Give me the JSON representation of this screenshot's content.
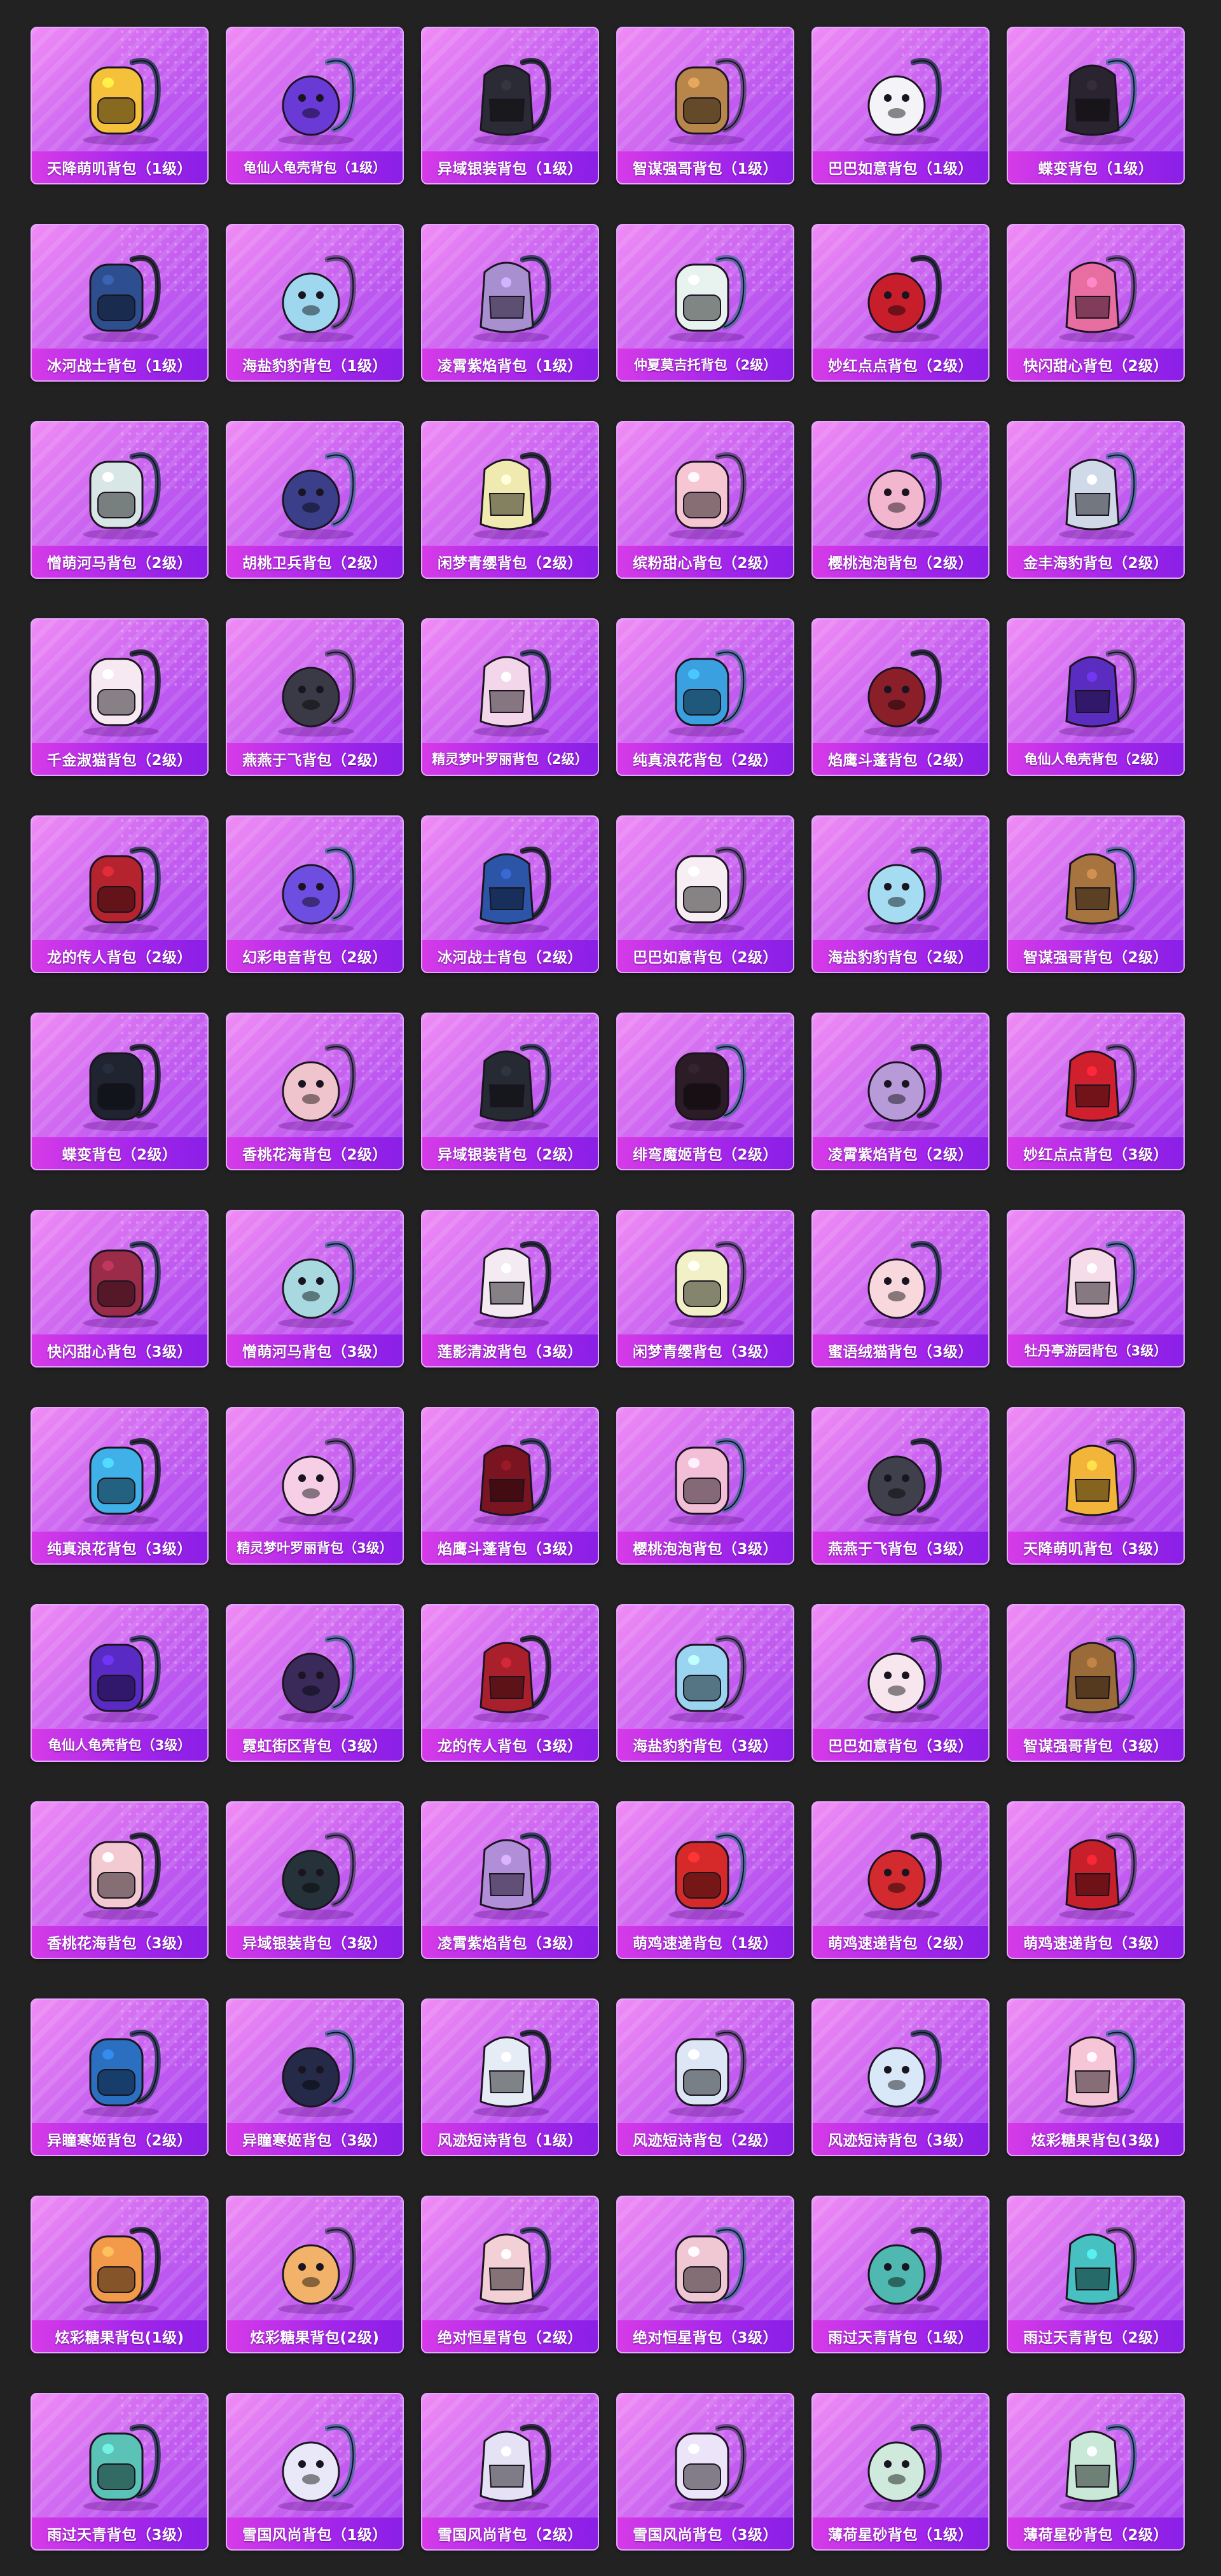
{
  "items": [
    {
      "name": "天降萌叽背包（1级）",
      "icon": "yellow-chick-backpack-icon",
      "color": "#f5c13a"
    },
    {
      "name": "龟仙人龟壳背包（1级）",
      "icon": "turtle-shell-backpack-icon",
      "color": "#6a3ad6"
    },
    {
      "name": "异域银装背包（1级）",
      "icon": "black-tech-backpack-icon",
      "color": "#2b2b35"
    },
    {
      "name": "智谋强哥背包（1级）",
      "icon": "brown-dog-backpack-icon",
      "color": "#b8864a"
    },
    {
      "name": "巴巴如意背包（1级）",
      "icon": "white-bunny-backpack-icon",
      "color": "#f4f4f8"
    },
    {
      "name": "蝶变背包（1级）",
      "icon": "black-butterfly-backpack-icon",
      "color": "#2a2430"
    },
    {
      "name": "冰河战士背包（1级）",
      "icon": "blue-armor-backpack-icon",
      "color": "#2e4f8f"
    },
    {
      "name": "海盐豹豹背包（1级）",
      "icon": "seal-backpack-icon",
      "color": "#9fd7ef"
    },
    {
      "name": "凌霄紫焰背包（1级）",
      "icon": "purple-amulet-backpack-icon",
      "color": "#a88fd0"
    },
    {
      "name": "仲夏莫吉托背包（2级）",
      "icon": "mint-bag-backpack-icon",
      "color": "#e8f3f0"
    },
    {
      "name": "妙红点点背包（2级）",
      "icon": "ladybug-backpack-icon",
      "color": "#c81d2b"
    },
    {
      "name": "快闪甜心背包（2级）",
      "icon": "pink-clock-backpack-icon",
      "color": "#e86da0"
    },
    {
      "name": "憎萌河马背包（2级）",
      "icon": "hippo-backpack-icon",
      "color": "#d9e6e6"
    },
    {
      "name": "胡桃卫兵背包（2级）",
      "icon": "nutcracker-backpack-icon",
      "color": "#3b3f8a"
    },
    {
      "name": "闲梦青缨背包（2级）",
      "icon": "yellow-dress-backpack-icon",
      "color": "#f0eab0"
    },
    {
      "name": "缤粉甜心背包（2级）",
      "icon": "pink-sweet-backpack-icon",
      "color": "#f6c7d3"
    },
    {
      "name": "樱桃泡泡背包（2级）",
      "icon": "pink-bow-backpack-icon",
      "color": "#f3b6cf"
    },
    {
      "name": "金丰海豹背包（2级）",
      "icon": "gold-seal-backpack-icon",
      "color": "#cfd9e8"
    },
    {
      "name": "千金淑猫背包（2级）",
      "icon": "white-cat-backpack-icon",
      "color": "#f6e9f1"
    },
    {
      "name": "燕燕于飞背包（2级）",
      "icon": "round-charm-backpack-icon",
      "color": "#3a3a46"
    },
    {
      "name": "精灵梦叶罗丽背包（2级）",
      "icon": "heart-fairy-backpack-icon",
      "color": "#f3d6ea"
    },
    {
      "name": "纯真浪花背包（2级）",
      "icon": "ice-cream-backpack-icon",
      "color": "#3aa0e0"
    },
    {
      "name": "焰鹰斗蓬背包（2级）",
      "icon": "red-mech-backpack-icon",
      "color": "#8a1f2a"
    },
    {
      "name": "龟仙人龟壳背包（2级）",
      "icon": "turtle-shell-backpack-icon",
      "color": "#5b2cc0"
    },
    {
      "name": "龙的传人背包（2级）",
      "icon": "dragon-red-backpack-icon",
      "color": "#b5232e"
    },
    {
      "name": "幻彩电音背包（2级）",
      "icon": "purple-owl-backpack-icon",
      "color": "#6e4ee0"
    },
    {
      "name": "冰河战士背包（2级）",
      "icon": "blue-armor-backpack-icon",
      "color": "#2c55a8"
    },
    {
      "name": "巴巴如意背包（2级）",
      "icon": "white-bunny-backpack-icon",
      "color": "#f6eef2"
    },
    {
      "name": "海盐豹豹背包（2级）",
      "icon": "seal-backpack-icon",
      "color": "#a6dcf2"
    },
    {
      "name": "智谋强哥背包（2级）",
      "icon": "brown-dog-backpack-icon",
      "color": "#a7743f"
    },
    {
      "name": "蝶变背包（2级）",
      "icon": "black-butterfly-backpack-icon",
      "color": "#1f2430"
    },
    {
      "name": "香桃花海背包（2级）",
      "icon": "pink-flower-backpack-icon",
      "color": "#f0c4cc"
    },
    {
      "name": "异域银装背包（2级）",
      "icon": "black-tech-backpack-icon",
      "color": "#262a33"
    },
    {
      "name": "绯弯魔姬背包（2级）",
      "icon": "bat-backpack-icon",
      "color": "#2b1c26"
    },
    {
      "name": "凌霄紫焰背包（2级）",
      "icon": "purple-amulet-backpack-icon",
      "color": "#b79ad8"
    },
    {
      "name": "妙红点点背包（3级）",
      "icon": "ladybug-backpack-icon",
      "color": "#d0202e"
    },
    {
      "name": "快闪甜心背包（3级）",
      "icon": "pink-clock-backpack-icon",
      "color": "#9a2c4a"
    },
    {
      "name": "憎萌河马背包（3级）",
      "icon": "hippo-backpack-icon",
      "color": "#a8d8e0"
    },
    {
      "name": "莲影清波背包（3级）",
      "icon": "lotus-backpack-icon",
      "color": "#f4eaf2"
    },
    {
      "name": "闲梦青缨背包（3级）",
      "icon": "yellow-dress-backpack-icon",
      "color": "#f2f0c6"
    },
    {
      "name": "蜜语绒猫背包（3级）",
      "icon": "plush-cat-backpack-icon",
      "color": "#f8d8dc"
    },
    {
      "name": "牡丹亭游园背包（3级）",
      "icon": "peony-backpack-icon",
      "color": "#f6dce8"
    },
    {
      "name": "纯真浪花背包（3级）",
      "icon": "ice-cream-backpack-icon",
      "color": "#3fb0e8"
    },
    {
      "name": "精灵梦叶罗丽背包（3级）",
      "icon": "heart-fairy-backpack-icon",
      "color": "#f6cfe6"
    },
    {
      "name": "焰鹰斗蓬背包（3级）",
      "icon": "red-mech-backpack-icon",
      "color": "#7a1420"
    },
    {
      "name": "樱桃泡泡背包（3级）",
      "icon": "pink-bow-backpack-icon",
      "color": "#f2bfd6"
    },
    {
      "name": "燕燕于飞背包（3级）",
      "icon": "round-charm-backpack-icon",
      "color": "#40404c"
    },
    {
      "name": "天降萌叽背包（3级）",
      "icon": "yellow-chick-backpack-icon",
      "color": "#f2b53a"
    },
    {
      "name": "龟仙人龟壳背包（3级）",
      "icon": "turtle-shell-backpack-icon",
      "color": "#5a2bc4"
    },
    {
      "name": "霓虹街区背包（3级）",
      "icon": "neon-street-backpack-icon",
      "color": "#3a2a5a"
    },
    {
      "name": "龙的传人背包（3级）",
      "icon": "dragon-red-backpack-icon",
      "color": "#a9202c"
    },
    {
      "name": "海盐豹豹背包（3级）",
      "icon": "seal-backpack-icon",
      "color": "#9ad4f0"
    },
    {
      "name": "巴巴如意背包（3级）",
      "icon": "white-bunny-backpack-icon",
      "color": "#f7e6ee"
    },
    {
      "name": "智谋强哥背包（3级）",
      "icon": "brown-dog-backpack-icon",
      "color": "#9a6a38"
    },
    {
      "name": "香桃花海背包（3级）",
      "icon": "pink-flower-backpack-icon",
      "color": "#f3cad2"
    },
    {
      "name": "异域银装背包（3级）",
      "icon": "black-tech-backpack-icon",
      "color": "#25323a"
    },
    {
      "name": "凌霄紫焰背包（3级）",
      "icon": "purple-amulet-backpack-icon",
      "color": "#b08fd8"
    },
    {
      "name": "萌鸡速递背包（1级）",
      "icon": "chick-courier-backpack-icon",
      "color": "#d62a2a"
    },
    {
      "name": "萌鸡速递背包（2级）",
      "icon": "chick-courier-backpack-icon",
      "color": "#d32a30"
    },
    {
      "name": "萌鸡速递背包（3级）",
      "icon": "chick-courier-backpack-icon",
      "color": "#c8202a"
    },
    {
      "name": "异瞳寒姬背包（2级）",
      "icon": "ice-cat-backpack-icon",
      "color": "#2a6fc0"
    },
    {
      "name": "异瞳寒姬背包（3级）",
      "icon": "ice-cat-backpack-icon",
      "color": "#242a48"
    },
    {
      "name": "风迹短诗背包（1级）",
      "icon": "poem-satchel-backpack-icon",
      "color": "#e6ecf6"
    },
    {
      "name": "风迹短诗背包（2级）",
      "icon": "poem-satchel-backpack-icon",
      "color": "#dce6f4"
    },
    {
      "name": "风迹短诗背包（3级）",
      "icon": "poem-satchel-backpack-icon",
      "color": "#d8e8f8"
    },
    {
      "name": "炫彩糖果背包(3级)",
      "icon": "donut-backpack-icon",
      "color": "#f6c6d6"
    },
    {
      "name": "炫彩糖果背包(1级)",
      "icon": "donut-backpack-icon",
      "color": "#f29a4a"
    },
    {
      "name": "炫彩糖果背包(2级)",
      "icon": "donut-backpack-icon",
      "color": "#f3b26a"
    },
    {
      "name": "绝对恒星背包（2级）",
      "icon": "popcorn-backpack-icon",
      "color": "#f2d0d6"
    },
    {
      "name": "绝对恒星背包（3级）",
      "icon": "popcorn-backpack-icon",
      "color": "#f0c8d4"
    },
    {
      "name": "雨过天青背包（1级）",
      "icon": "teal-gourd-backpack-icon",
      "color": "#4fb8b0"
    },
    {
      "name": "雨过天青背包（2级）",
      "icon": "teal-gourd-backpack-icon",
      "color": "#46c0c0"
    },
    {
      "name": "雨过天青背包（3级）",
      "icon": "teal-gourd-backpack-icon",
      "color": "#5ac2b6"
    },
    {
      "name": "雪国风尚背包（1级）",
      "icon": "snow-bunny-backpack-icon",
      "color": "#e8e8f8"
    },
    {
      "name": "雪国风尚背包（2级）",
      "icon": "snow-penguin-backpack-icon",
      "color": "#e6e2f6"
    },
    {
      "name": "雪国风尚背包（3级）",
      "icon": "snow-penguin-backpack-icon",
      "color": "#ece4f8"
    },
    {
      "name": "薄荷星砂背包（1级）",
      "icon": "mint-star-backpack-icon",
      "color": "#cfeadc"
    },
    {
      "name": "薄荷星砂背包（2级）",
      "icon": "mint-star-backpack-icon",
      "color": "#c9e8d8"
    }
  ]
}
